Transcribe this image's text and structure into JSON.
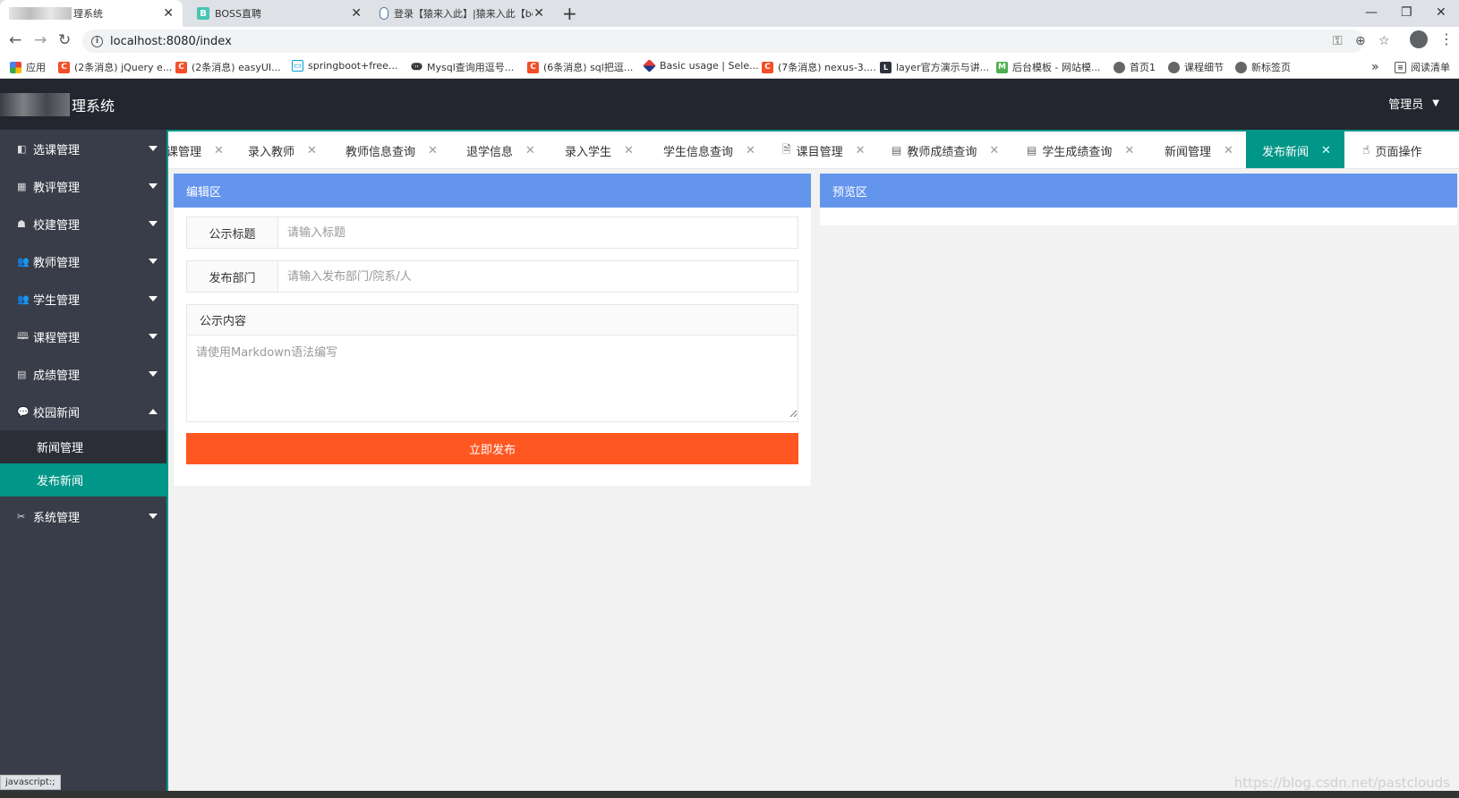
{
  "browser": {
    "tabs": [
      {
        "title": "理系统",
        "close": "✕",
        "active": true
      },
      {
        "title": "BOSS直聘",
        "close": "✕",
        "favicon": "B"
      },
      {
        "title": "登录【猿来入此】|猿来入此【be",
        "close": "✕"
      }
    ],
    "new_tab": "+",
    "window_controls": {
      "minimize": "—",
      "restore": "❐",
      "close": "✕"
    },
    "url": "localhost:8080/index",
    "bookmarks": [
      {
        "label": "应用",
        "icon": "apps-icon"
      },
      {
        "label": "(2条消息) jQuery e...",
        "icon": "C"
      },
      {
        "label": "(2条消息) easyUI...",
        "icon": "C"
      },
      {
        "label": "springboot+free...",
        "icon": "tv-icon"
      },
      {
        "label": "Mysql查询用逗号...",
        "icon": "paw-icon"
      },
      {
        "label": "(6条消息) sql把逗...",
        "icon": "C"
      },
      {
        "label": "Basic usage | Sele...",
        "icon": "stack-icon"
      },
      {
        "label": "(7条消息) nexus-3....",
        "icon": "C"
      },
      {
        "label": "layer官方演示与讲...",
        "icon": "layer-icon"
      },
      {
        "label": "后台模板 - 网站模...",
        "icon": "M"
      },
      {
        "label": "首页1",
        "icon": "globe-icon"
      },
      {
        "label": "课程细节",
        "icon": "globe-icon"
      },
      {
        "label": "新标签页",
        "icon": "globe-icon"
      }
    ],
    "more": "»",
    "reading_list": "阅读清单",
    "status": "javascript:;"
  },
  "header": {
    "title": "理系统",
    "user": "管理员"
  },
  "sidebar": {
    "items": [
      {
        "label": "选课管理",
        "icon": "◧"
      },
      {
        "label": "教评管理",
        "icon": "▦"
      },
      {
        "label": "校建管理",
        "icon": "☗"
      },
      {
        "label": "教师管理",
        "icon": "👥"
      },
      {
        "label": "学生管理",
        "icon": "👥"
      },
      {
        "label": "课程管理",
        "icon": "🕮"
      },
      {
        "label": "成绩管理",
        "icon": "▤"
      },
      {
        "label": "校园新闻",
        "icon": "💬"
      },
      {
        "label": "系统管理",
        "icon": "✂"
      }
    ],
    "sub_items": [
      {
        "label": "新闻管理"
      },
      {
        "label": "发布新闻"
      }
    ]
  },
  "page_tabs": [
    {
      "label": "课管理"
    },
    {
      "label": "录入教师"
    },
    {
      "label": "教师信息查询"
    },
    {
      "label": "退学信息"
    },
    {
      "label": "录入学生"
    },
    {
      "label": "学生信息查询"
    },
    {
      "label": "课目管理"
    },
    {
      "label": "教师成绩查询"
    },
    {
      "label": "学生成绩查询"
    },
    {
      "label": "新闻管理"
    },
    {
      "label": "发布新闻"
    },
    {
      "label": "页面操作"
    }
  ],
  "editor": {
    "title": "编辑区",
    "title_label": "公示标题",
    "title_placeholder": "请输入标题",
    "dept_label": "发布部门",
    "dept_placeholder": "请输入发布部门/院系/人",
    "content_label": "公示内容",
    "content_placeholder": "请使用Markdown语法编写",
    "submit": "立即发布"
  },
  "preview": {
    "title": "预览区"
  },
  "watermark": "https://blog.csdn.net/pastclouds"
}
